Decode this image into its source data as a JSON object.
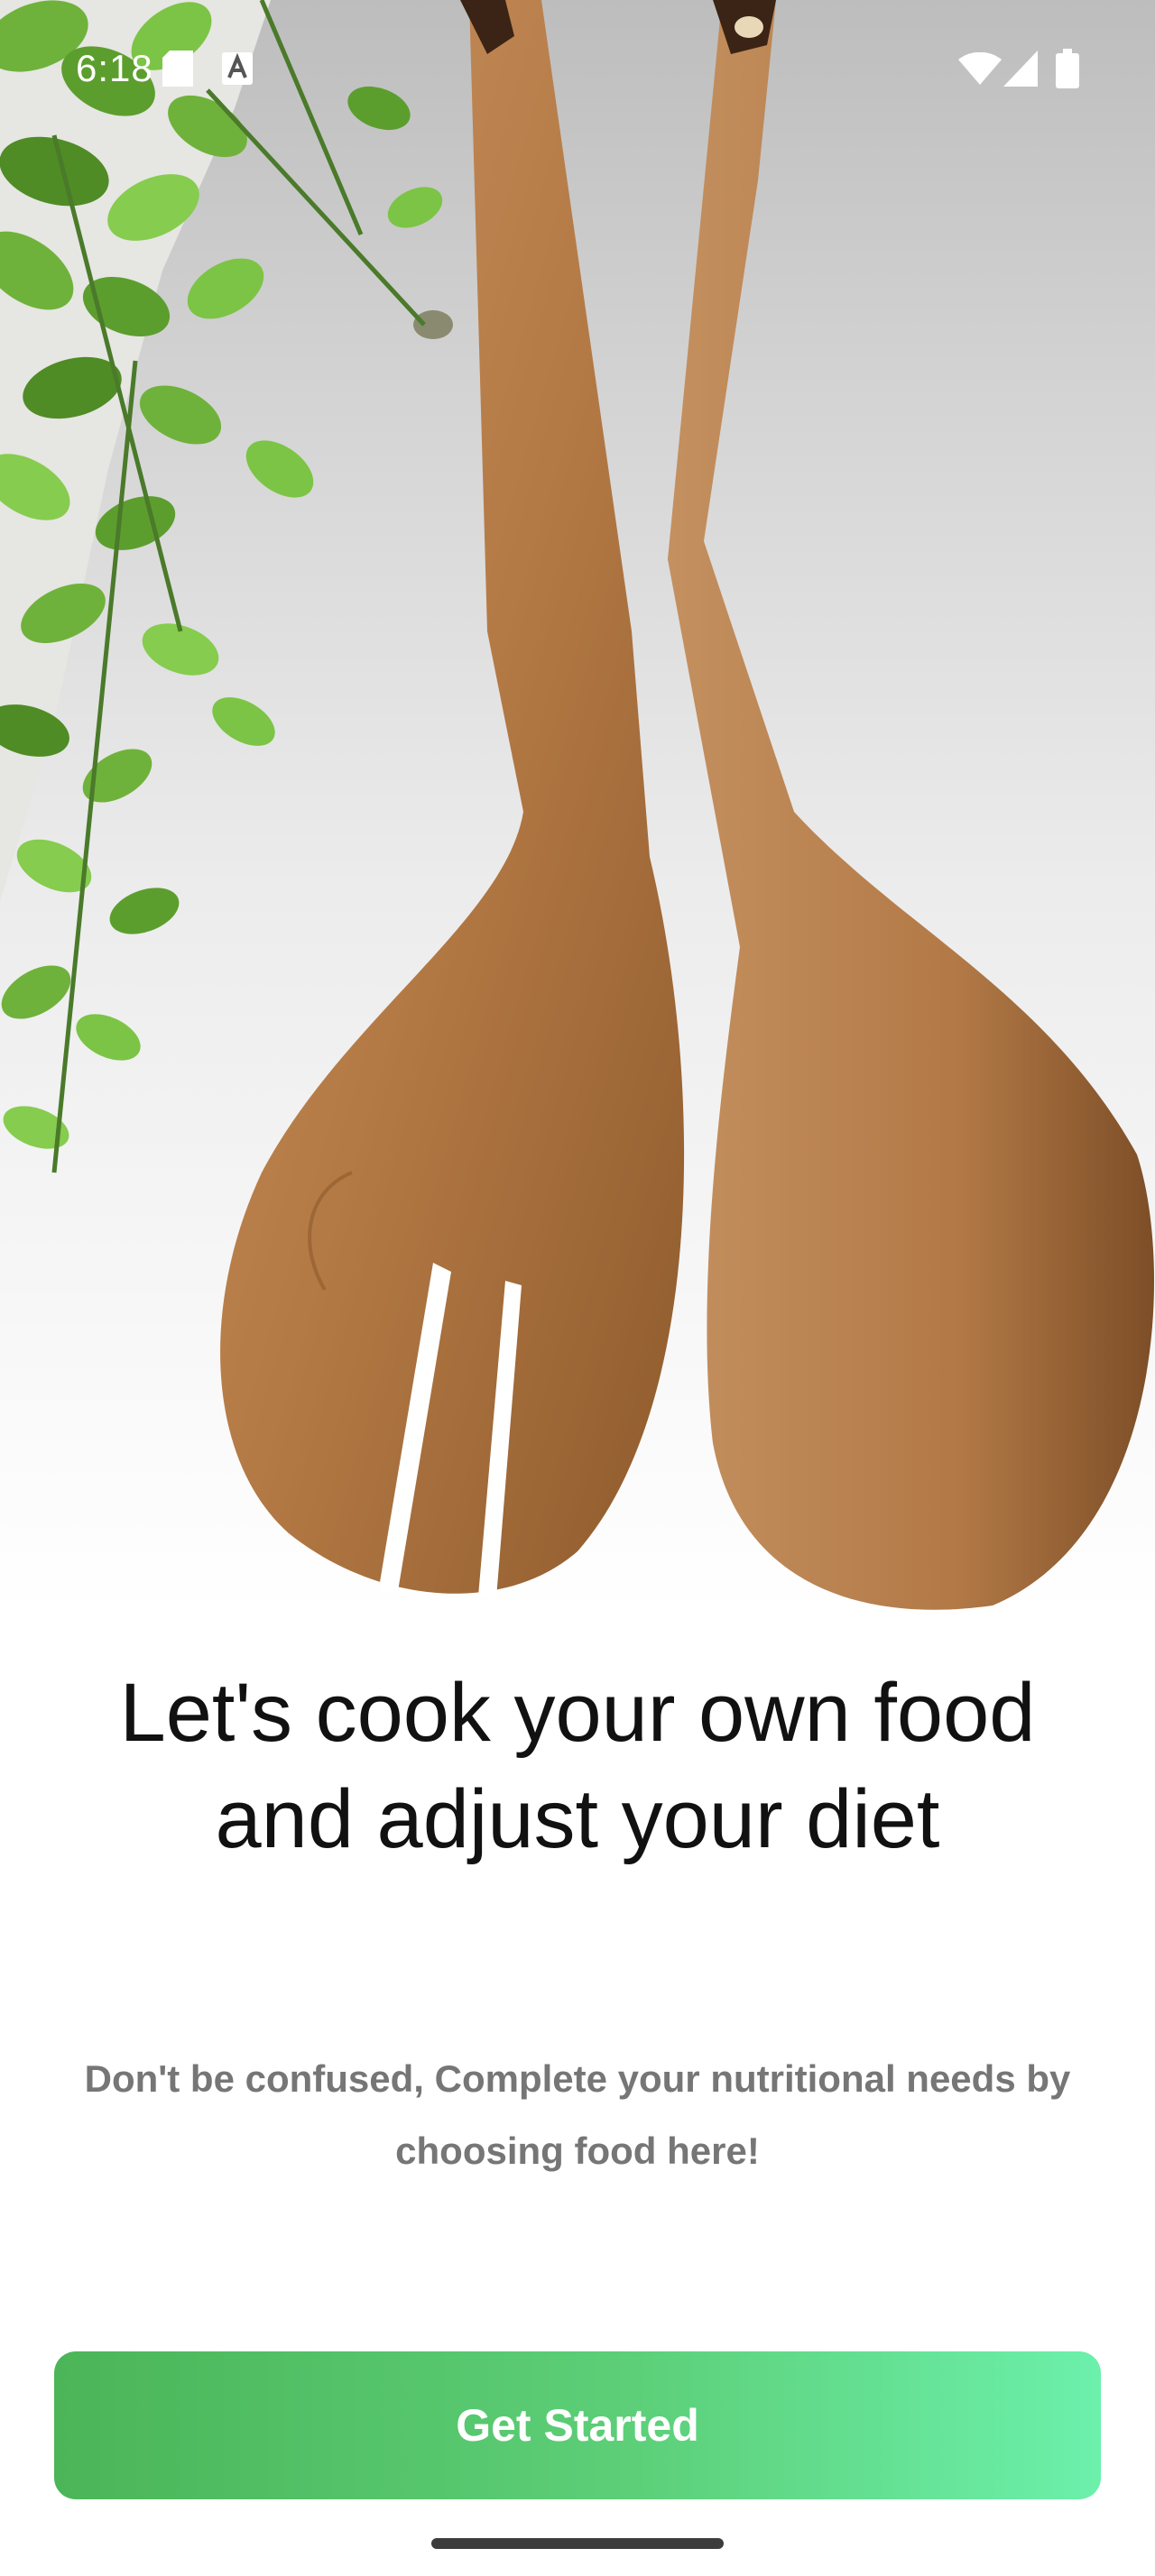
{
  "status_bar": {
    "time": "6:18",
    "icons": [
      "sd-card-icon",
      "keyboard-a-icon",
      "wifi-icon",
      "signal-icon",
      "battery-icon"
    ]
  },
  "hero": {
    "image": "wooden-salad-servers-with-eucalyptus-leaves"
  },
  "onboarding": {
    "title": "Let's cook your own food and adjust your diet",
    "subtitle": "Don't be confused, Complete your nutritional needs by choosing food here!",
    "cta_label": "Get Started"
  },
  "colors": {
    "button_start": "#4bb558",
    "button_end": "#6cf0ab",
    "title": "#111111",
    "subtitle": "#767676",
    "wood": "#b47a45"
  }
}
